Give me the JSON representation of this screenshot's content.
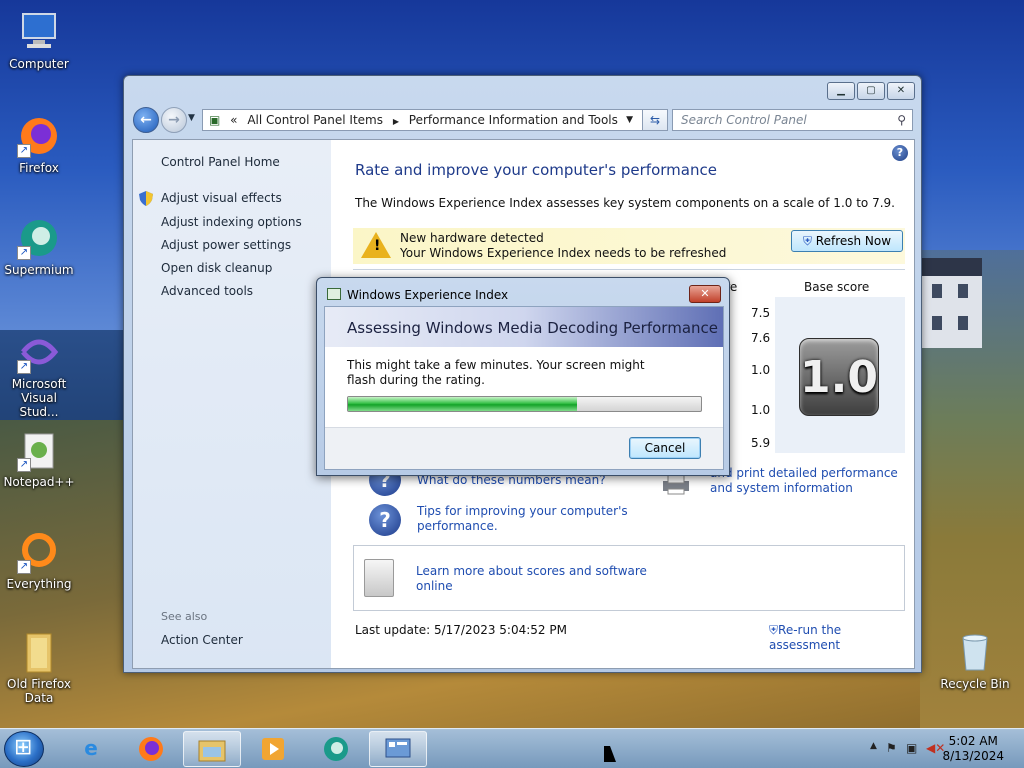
{
  "desktop": {
    "icons": [
      {
        "label": "Computer"
      },
      {
        "label": "Firefox"
      },
      {
        "label": "Supermium"
      },
      {
        "label": "Microsoft Visual Stud..."
      },
      {
        "label": "Notepad++"
      },
      {
        "label": "Everything"
      },
      {
        "label": "Old Firefox Data"
      },
      {
        "label": "Recycle Bin"
      }
    ]
  },
  "window": {
    "address": {
      "chevrons": "«",
      "crumb1": "All Control Panel Items",
      "sep": "▶",
      "crumb2": "Performance Information and Tools"
    },
    "search_placeholder": "Search Control Panel",
    "sidebar": {
      "home": "Control Panel Home",
      "links": [
        "Adjust visual effects",
        "Adjust indexing options",
        "Adjust power settings",
        "Open disk cleanup",
        "Advanced tools"
      ],
      "see_also": "See also",
      "action_center": "Action Center"
    },
    "main": {
      "title": "Rate and improve your computer's performance",
      "description": "The Windows Experience Index assesses key system components on a scale of 1.0 to 7.9.",
      "warning_line1": "New hardware detected",
      "warning_line2": "Your Windows Experience Index needs to be refreshed",
      "refresh_button": "Refresh Now",
      "col_subscore": "score",
      "col_basescore": "Base score",
      "subscores": [
        "7.5",
        "7.6",
        "1.0",
        "1.0",
        "5.9"
      ],
      "base_score": "1.0",
      "link_numbers": "What do these numbers mean?",
      "link_print_1": "and print detailed performance",
      "link_print_2": "and system information",
      "link_tips_1": "Tips for improving your computer's",
      "link_tips_2": "performance.",
      "link_learn_1": "Learn more about scores and software",
      "link_learn_2": "online",
      "last_update": "Last update: 5/17/2023 5:04:52 PM",
      "rerun": "Re-run the assessment"
    }
  },
  "dialog": {
    "title": "Windows Experience Index",
    "heading": "Assessing Windows Media Decoding Performance",
    "message": "This might take a few minutes. Your screen might flash during the rating.",
    "progress": 0.65,
    "cancel": "Cancel"
  },
  "taskbar": {
    "time": "5:02 AM",
    "date": "8/13/2024"
  }
}
